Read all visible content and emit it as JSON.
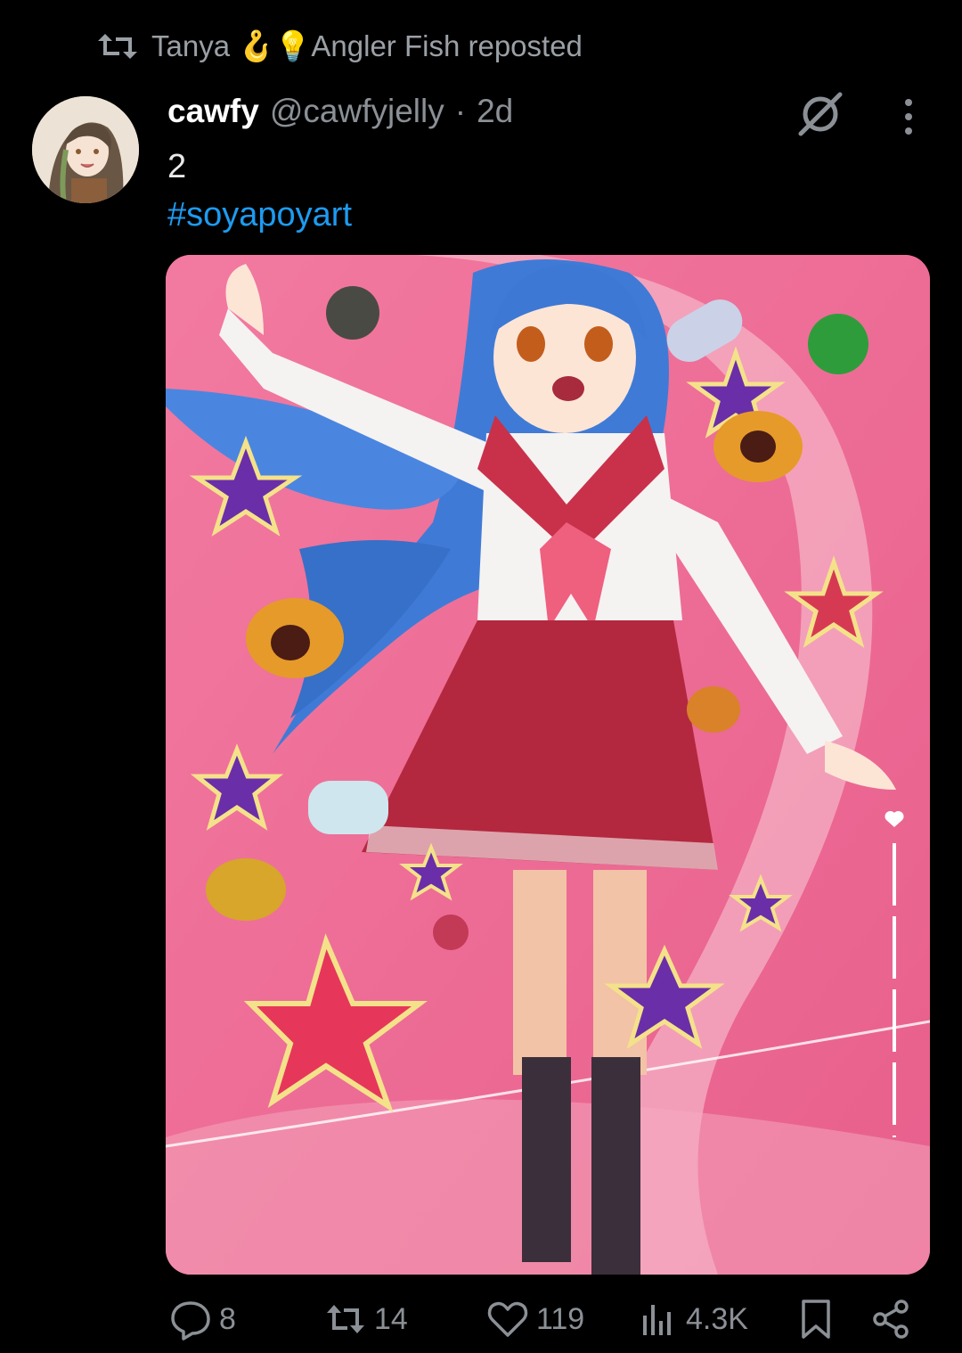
{
  "repost": {
    "text": "Tanya 🪝💡Angler Fish reposted"
  },
  "tweet": {
    "display_name": "cawfy",
    "handle": "@cawfyjelly",
    "separator": "·",
    "time": "2d",
    "text": "2",
    "hashtag": "#soyapoyart"
  },
  "actions": {
    "replies": "8",
    "reposts": "14",
    "likes": "119",
    "views": "4.3K"
  },
  "colors": {
    "background": "#000000",
    "link": "#1d9bf0",
    "secondary_text": "#8b9096",
    "media_bg": "#ed6f97"
  },
  "icons": [
    "repost-icon",
    "grok-icon",
    "more-icon",
    "reply-icon",
    "retweet-icon",
    "like-icon",
    "views-icon",
    "bookmark-icon",
    "share-icon"
  ]
}
